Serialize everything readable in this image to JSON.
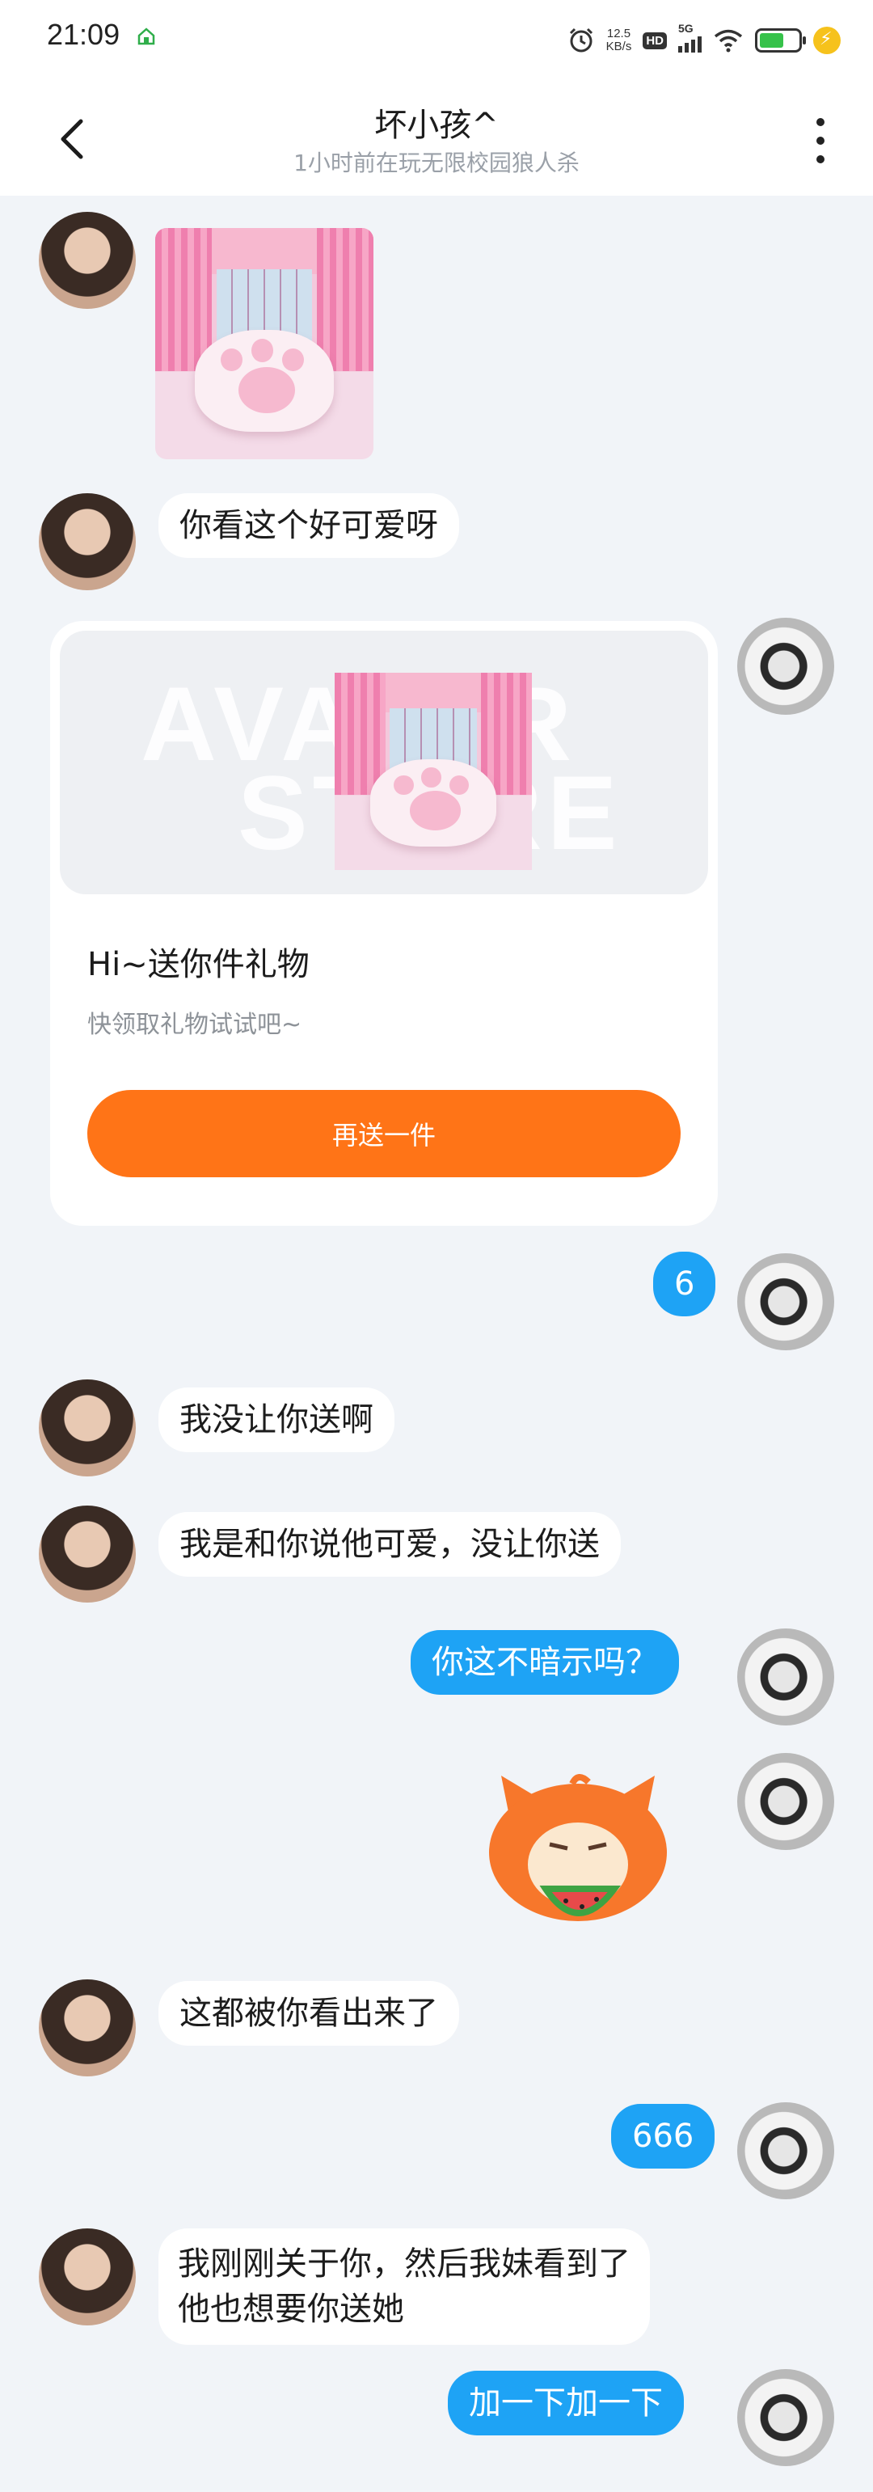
{
  "status_bar": {
    "time": "21:09",
    "net_speed_value": "12.5",
    "net_speed_unit": "KB/s",
    "hd": "HD",
    "network": "5G",
    "battery_color": "#36c24a"
  },
  "header": {
    "title": "坏小孩^",
    "subtitle": "1小时前在玩无限校园狼人杀"
  },
  "gift_card": {
    "watermark_line1": "AVATAR",
    "watermark_line2": "STORE",
    "title": "Hi~送你件礼物",
    "description": "快领取礼物试试吧~",
    "button": "再送一件",
    "button_color": "#ff7417"
  },
  "messages": {
    "m1": "你看这个好可爱呀",
    "m2": "6",
    "m3": "我没让你送啊",
    "m4": "我是和你说他可爱，没让你送",
    "m5": "你这不暗示吗？",
    "m6": "这都被你看出来了",
    "m7": "666",
    "m8_line1": "我刚刚关于你，然后我妹看到了",
    "m8_line2": "他也想要你送她",
    "m9": "加一下加一下"
  },
  "colors": {
    "outgoing_bubble": "#1ea3f5",
    "incoming_bubble": "#ffffff",
    "chat_background": "#f1f4f8"
  }
}
